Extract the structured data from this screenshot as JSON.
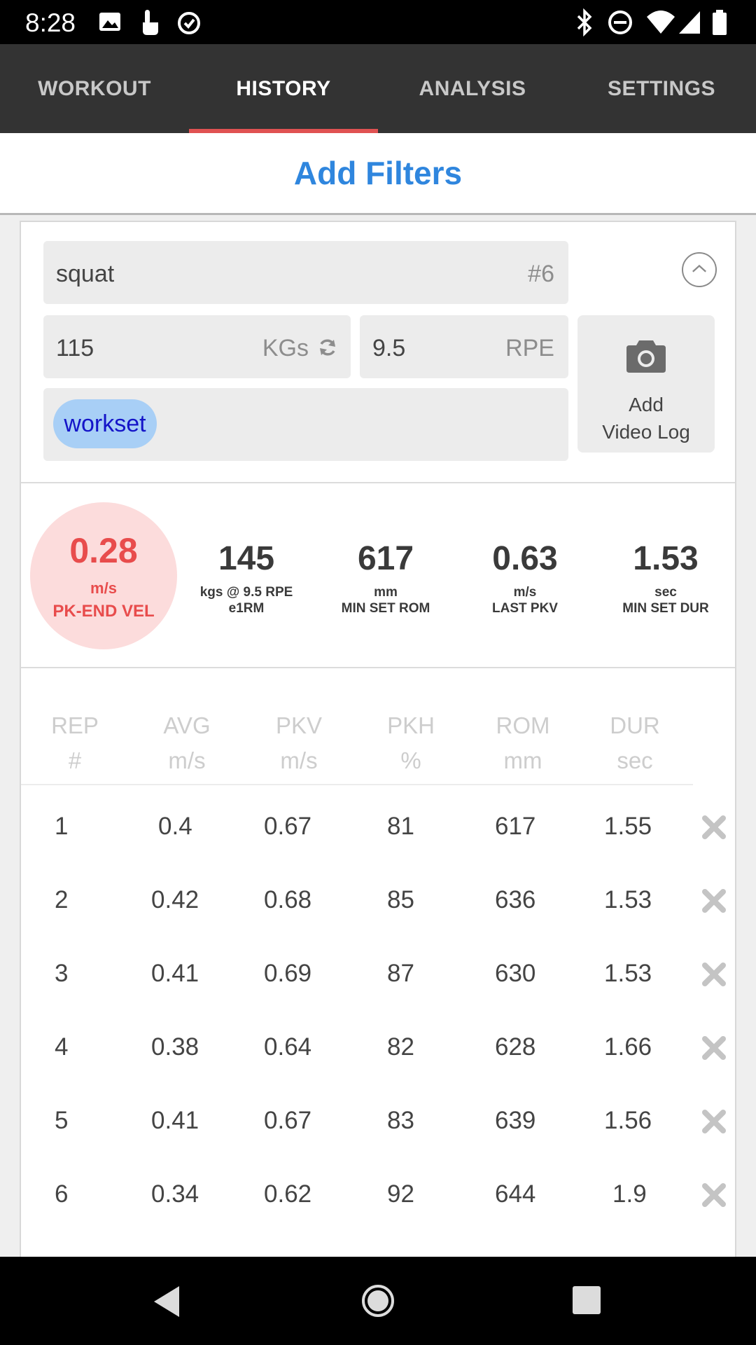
{
  "status_bar": {
    "time": "8:28",
    "left_icons": [
      "image-icon",
      "touch-icon",
      "alarm-icon"
    ],
    "right_icons": [
      "bluetooth-icon",
      "do-not-disturb-icon",
      "wifi-icon",
      "signal-icon",
      "battery-icon"
    ]
  },
  "tabs": [
    {
      "label": "WORKOUT",
      "active": false
    },
    {
      "label": "HISTORY",
      "active": true
    },
    {
      "label": "ANALYSIS",
      "active": false
    },
    {
      "label": "SETTINGS",
      "active": false
    }
  ],
  "filter_bar": {
    "label": "Add Filters"
  },
  "set_card": {
    "exercise": "squat",
    "set_number": "#6",
    "weight": "115",
    "weight_unit": "KGs",
    "rpe_value": "9.5",
    "rpe_label": "RPE",
    "video_button": {
      "line1": "Add",
      "line2": "Video Log"
    },
    "tag": "workset"
  },
  "summary": {
    "velocity": {
      "value": "0.28",
      "unit": "m/s",
      "label": "PK-END VEL"
    },
    "stats": [
      {
        "value": "145",
        "unit": "kgs @ 9.5 RPE",
        "label": "e1RM"
      },
      {
        "value": "617",
        "unit": "mm",
        "label": "MIN SET ROM"
      },
      {
        "value": "0.63",
        "unit": "m/s",
        "label": "LAST PKV"
      },
      {
        "value": "1.53",
        "unit": "sec",
        "label": "MIN SET DUR"
      }
    ]
  },
  "table": {
    "headers": [
      {
        "line1": "REP",
        "line2": "#"
      },
      {
        "line1": "AVG",
        "line2": "m/s"
      },
      {
        "line1": "PKV",
        "line2": "m/s"
      },
      {
        "line1": "PKH",
        "line2": "%"
      },
      {
        "line1": "ROM",
        "line2": "mm"
      },
      {
        "line1": "DUR",
        "line2": "sec"
      }
    ],
    "rows": [
      {
        "rep": "1",
        "avg": "0.4",
        "pkv": "0.67",
        "pkh": "81",
        "rom": "617",
        "dur": "1.55"
      },
      {
        "rep": "2",
        "avg": "0.42",
        "pkv": "0.68",
        "pkh": "85",
        "rom": "636",
        "dur": "1.53"
      },
      {
        "rep": "3",
        "avg": "0.41",
        "pkv": "0.69",
        "pkh": "87",
        "rom": "630",
        "dur": "1.53"
      },
      {
        "rep": "4",
        "avg": "0.38",
        "pkv": "0.64",
        "pkh": "82",
        "rom": "628",
        "dur": "1.66"
      },
      {
        "rep": "5",
        "avg": "0.41",
        "pkv": "0.67",
        "pkh": "83",
        "rom": "639",
        "dur": "1.56"
      },
      {
        "rep": "6",
        "avg": "0.34",
        "pkv": "0.62",
        "pkh": "92",
        "rom": "644",
        "dur": "1.9"
      }
    ]
  },
  "colors": {
    "accent": "#2f86de",
    "tab_indicator": "#e05252",
    "velocity": "#e84c4c",
    "tag_chip": "#a8cff6"
  }
}
